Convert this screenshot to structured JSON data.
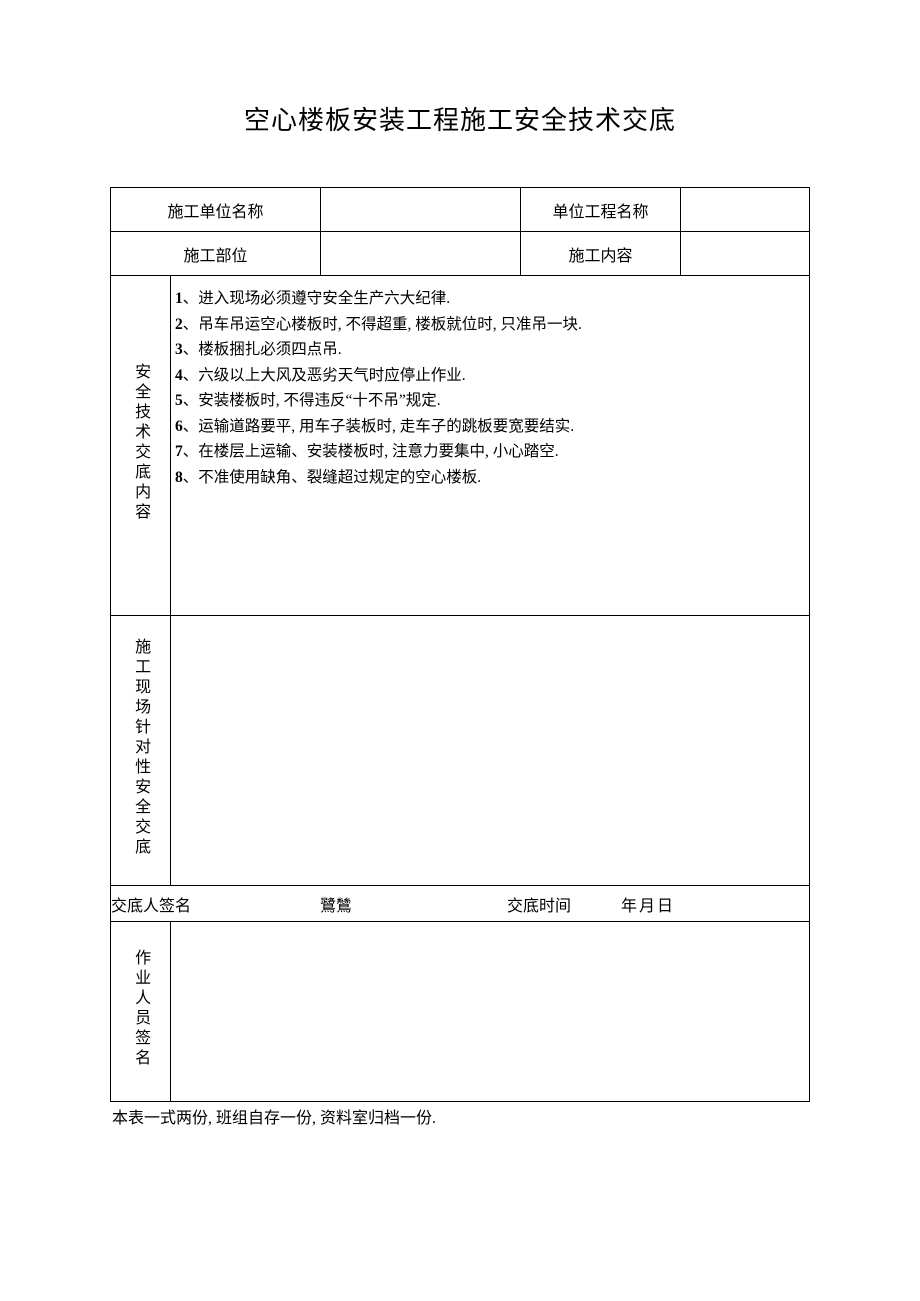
{
  "title": "空心楼板安装工程施工安全技术交底",
  "headers": {
    "unit_name_label": "施工单位名称",
    "project_name_label": "单位工程名称",
    "location_label": "施工部位",
    "content_label": "施工内容"
  },
  "values": {
    "unit_name": "",
    "project_name": "",
    "location": "",
    "content": ""
  },
  "sections": {
    "safety_label": "安全技术交底内容",
    "site_label": "施工现场针对性安全交底",
    "workers_label": "作业人员签名"
  },
  "rules": [
    {
      "n": "1",
      "t": "、进入现场必须遵守安全生产六大纪律."
    },
    {
      "n": "2",
      "t": "、吊车吊运空心楼板时, 不得超重, 楼板就位时, 只准吊一块."
    },
    {
      "n": "3",
      "t": "、楼板捆扎必须四点吊."
    },
    {
      "n": "4",
      "t": "、六级以上大风及恶劣天气时应停止作业."
    },
    {
      "n": "5",
      "t": "、安装楼板时, 不得违反“十不吊”规定."
    },
    {
      "n": "6",
      "t": "、运输道路要平, 用车子装板时, 走车子的跳板要宽要结实."
    },
    {
      "n": "7",
      "t": "、在楼层上运输、安装楼板时, 注意力要集中, 小心踏空."
    },
    {
      "n": "8",
      "t": "、不准使用缺角、裂缝超过规定的空心楼板."
    }
  ],
  "signature": {
    "signer_label": "交底人签名",
    "glyph": "鷺鷥",
    "time_label": "交底时间",
    "date_text": "年月日"
  },
  "footnote": "本表一式两份, 班组自存一份, 资料室归档一份."
}
